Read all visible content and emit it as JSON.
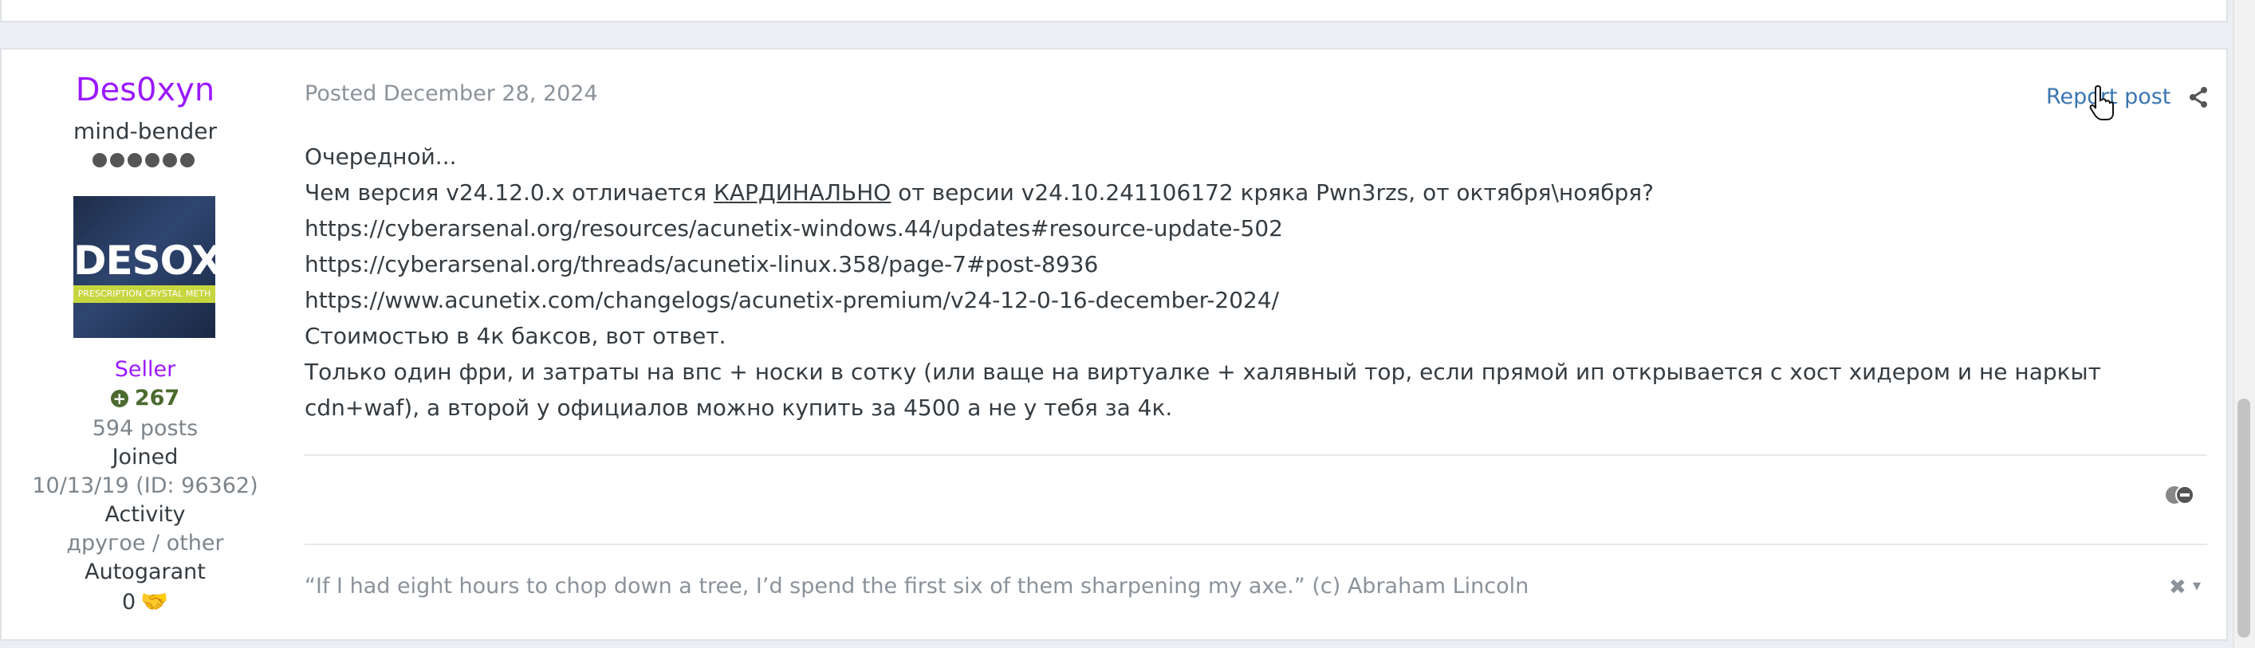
{
  "author": {
    "name": "Des0xyn",
    "title": "mind-bender",
    "avatar_word": "DESOXYN",
    "avatar_band": "PRESCRIPTION CRYSTAL METH",
    "group": "Seller",
    "reputation": "267",
    "posts": "594 posts",
    "joined_label": "Joined",
    "joined_value": "10/13/19 (ID: 96362)",
    "activity_label": "Activity",
    "activity_value": "другое / other",
    "autogarant_label": "Autogarant",
    "autogarant_value": "0"
  },
  "post": {
    "posted": "Posted December 28, 2024",
    "report_label": "Report post",
    "lines": [
      "Очередной...",
      "https://cyberarsenal.org/resources/acunetix-windows.44/updates#resource-update-502",
      "https://cyberarsenal.org/threads/acunetix-linux.358/page-7#post-8936",
      "https://www.acunetix.com/changelogs/acunetix-premium/v24-12-0-16-december-2024/",
      "Стоимостью в 4к баксов, вот ответ.",
      "Только один фри, и затраты на впс + носки в сотку (или ваще на виртуалке + халявный тор, если прямой ип открывается с хост хидером и не наркыт cdn+waf), а второй у официалов можно купить за 4500 а не у тебя за 4к."
    ],
    "line2_before": "Чем версия v24.12.0.x отличается ",
    "line2_caps": "КАРДИНАЛЬНО",
    "line2_after": " от версии v24.10.241106172 кряка Pwn3rzs, от октября\\ноября?"
  },
  "signature": {
    "text": "“If I had eight hours to chop down a tree, I’d spend the first six of them sharpening my axe.”  (c) Abraham Lincoln"
  },
  "icons": {
    "reputation": "plus-circle-icon",
    "handshake": "handshake-icon",
    "share": "share-icon",
    "react": "reaction-icon",
    "close": "close-icon",
    "caret": "caret-down-icon"
  }
}
